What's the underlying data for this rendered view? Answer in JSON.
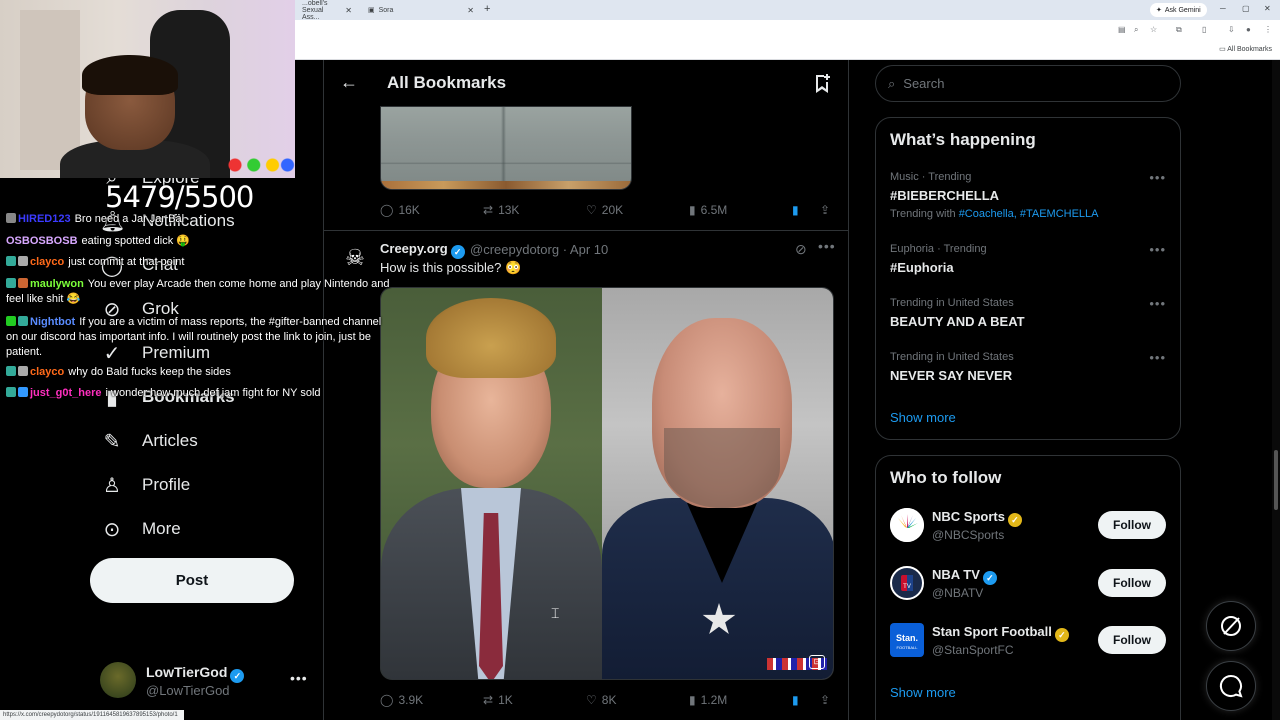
{
  "browser": {
    "tabs": [
      {
        "label": "...obell's Sexual Ass...",
        "active": false
      },
      {
        "label": "Sora",
        "active": false
      }
    ],
    "ask_gemini": "Ask Gemini",
    "bookmarks_bar_label": "All Bookmarks",
    "status_url": "https://x.com/creepydotorg/status/1911645819637895153/photo/1"
  },
  "header": {
    "title": "All Bookmarks"
  },
  "tweet1": {
    "replies": "16K",
    "reposts": "13K",
    "likes": "20K",
    "views": "6.5M"
  },
  "tweet2": {
    "name": "Creepy.org",
    "handle_date": "@creepydotorg · Apr 10",
    "text": "How is this possible? 😳",
    "replies": "3.9K",
    "reposts": "1K",
    "likes": "8K",
    "views": "1.2M"
  },
  "nav": {
    "items": [
      {
        "label": "Explore"
      },
      {
        "label": "Notifications"
      },
      {
        "label": "Chat"
      },
      {
        "label": "Grok"
      },
      {
        "label": "Premium"
      },
      {
        "label": "Bookmarks"
      },
      {
        "label": "Articles"
      },
      {
        "label": "Profile"
      },
      {
        "label": "More"
      }
    ],
    "post_label": "Post"
  },
  "account": {
    "name": "LowTierGod",
    "handle": "@LowTierGod"
  },
  "stream": {
    "sub_count": "5479/5500",
    "chat": [
      {
        "user": "HIRED123",
        "color": "#3b3bff",
        "msg": "Bro need a Jar Jar Bal"
      },
      {
        "user": "OSBOSBOSB",
        "color": "#d8a8ff",
        "msg": "eating spotted dick 🤑"
      },
      {
        "user": "clayco",
        "color": "#ff6a1a",
        "msg": "just commit at that point"
      },
      {
        "user": "maulywon",
        "color": "#7cff3a",
        "msg": "You ever play Arcade then come home and play Nintendo and feel like shit 😂"
      },
      {
        "user": "Nightbot",
        "color": "#5a8cff",
        "msg": "If you are a victim of mass reports, the #gifter-banned channel on our discord has important info. I will routinely post the link to join, just be patient."
      },
      {
        "user": "clayco",
        "color": "#ff6a1a",
        "msg": "why do Bald fucks keep the sides"
      },
      {
        "user": "just_g0t_here",
        "color": "#ff2fbf",
        "msg": "i wonder how much def jam fight for NY sold"
      }
    ]
  },
  "search": {
    "placeholder": "Search"
  },
  "trending": {
    "title": "What’s happening",
    "items": [
      {
        "meta": "Music · Trending",
        "name": "#BIEBERCHELLA",
        "with_label": "Trending with",
        "with_tags": "#Coachella, #TAEMCHELLA"
      },
      {
        "meta": "Euphoria · Trending",
        "name": "#Euphoria"
      },
      {
        "meta": "Trending in United States",
        "name": "BEAUTY AND A BEAT"
      },
      {
        "meta": "Trending in United States",
        "name": "NEVER SAY NEVER"
      }
    ],
    "show_more": "Show more"
  },
  "who_to_follow": {
    "title": "Who to follow",
    "accounts": [
      {
        "name": "NBC Sports",
        "handle": "@NBCSports",
        "badge": "gold",
        "button": "Follow"
      },
      {
        "name": "NBA TV",
        "handle": "@NBATV",
        "badge": "blue",
        "button": "Follow"
      },
      {
        "name": "Stan Sport Football",
        "handle": "@StanSportFC",
        "badge": "gold",
        "button": "Follow"
      }
    ],
    "show_more": "Show more"
  },
  "colors": {
    "accent": "#1d9bf0",
    "gold": "#e2b719",
    "background": "#000000",
    "border": "#2f3336",
    "muted": "#71767b"
  }
}
